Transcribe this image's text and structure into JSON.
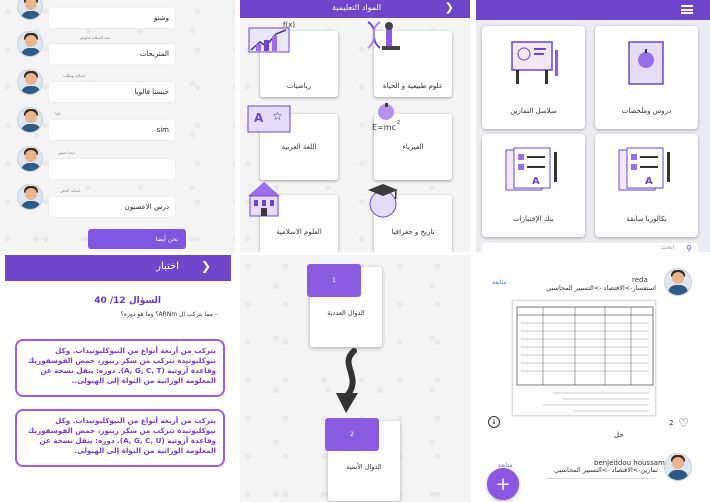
{
  "chat": {
    "messages": [
      {
        "author": "",
        "text": "وشنو",
        "side": "right"
      },
      {
        "author": "عبد السلام شاوش",
        "text": "المتربحات",
        "side": "right"
      },
      {
        "author": "اسلام بوطلب",
        "text": "جيسنا فالويا",
        "side": "right"
      },
      {
        "author": "اينا",
        "text": "sim",
        "side": "right"
      },
      {
        "author": "ديجا جيس",
        "text": "",
        "side": "right"
      },
      {
        "author": "لمنانة الحلي",
        "text": "درس الاعصبون",
        "side": "right"
      }
    ],
    "send_label": "نحن أيضا"
  },
  "subjects": {
    "title": "المواد التعليمية",
    "items": [
      {
        "label": "رياضيات",
        "icon": "math-graph-icon"
      },
      {
        "label": "علوم طبيعية و الحياة",
        "icon": "dna-microscope-icon"
      },
      {
        "label": "اللغة العربية",
        "icon": "arabic-letters-icon"
      },
      {
        "label": "الفيزياء",
        "icon": "physics-formula-icon"
      },
      {
        "label": "العلوم الاسلامية",
        "icon": "mosque-building-icon"
      },
      {
        "label": "تاريخ و جغرافيا",
        "icon": "graduation-globe-icon"
      }
    ]
  },
  "home": {
    "menu_icon": "hamburger-icon",
    "cards": [
      {
        "label": "دروس وملخصات",
        "icon": "book-apple-icon"
      },
      {
        "label": "سلاسل التمارين",
        "icon": "easel-icon"
      },
      {
        "label": "بكالوريا سابقة",
        "icon": "exam-sheets-icon"
      },
      {
        "label": "بنك الإختبارات",
        "icon": "exam-sheets-icon"
      }
    ],
    "search_placeholder": "ابحث"
  },
  "quiz": {
    "title": "اختبار",
    "counter": "السؤال 12/ 40",
    "question": "- مما يتركب ال ARNm؟ وما هو دوره؟",
    "answers": [
      "يتركب من أربعة أنواع من النيوكليوتيدات. وكل نيوكليوتيدة تتركب من سكر ريبوز، حمض الفوسفوريك وقاعدة آزوتية (A, G, C, T). دوره: ينقل نسخة عن المعلومة الوراثية من النواة إلى الهيولى..",
      "يتركب من أربعة أنواع من النيوكليوتيدات. وكل نيوكليوتيدة تتركب من سكر ريبوز، حمض الفوسفوريك وقاعدة آزوتية (A, G, C, U). دوره: ينقل نسخة عن المعلومة الوراثية من النواة إلى الهيولى."
    ]
  },
  "units": {
    "items": [
      {
        "number": "1",
        "title": "الدوال العددية"
      },
      {
        "number": "2",
        "title": "الدوال الأسية"
      }
    ]
  },
  "feed": {
    "posts": [
      {
        "user": "reda",
        "category": "استفسار->الاقتصاد ->التسيير المحاسبي",
        "follow": "متابعة",
        "likes": "2",
        "solution": "حل"
      },
      {
        "user": "benjeddou houssam",
        "category": "تمارين->الاقتصاد ->التسيير المحاسبي",
        "follow": "متابعة"
      }
    ],
    "fab_label": "+"
  },
  "colors": {
    "purple": "#6f46c9",
    "accent": "#8b5ce0",
    "answer": "#9c5cde"
  }
}
